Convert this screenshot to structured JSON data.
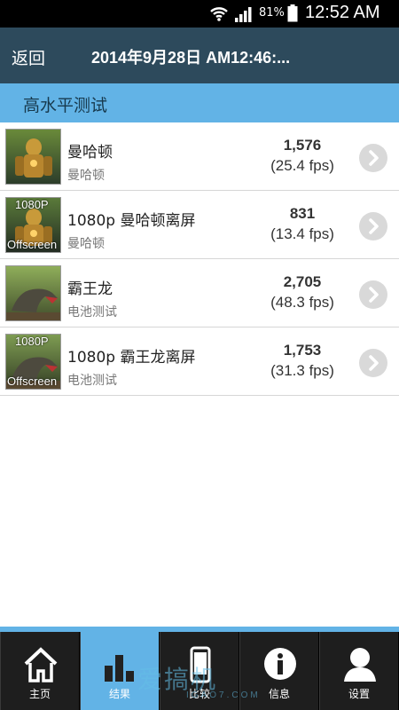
{
  "status_bar": {
    "battery_percent": "81%",
    "time": "12:52 AM",
    "icons": [
      "wifi-icon",
      "signal-icon",
      "battery-icon"
    ]
  },
  "header": {
    "back_label": "返回",
    "title": "2014年9月28日 AM12:46:..."
  },
  "section": {
    "title": "高水平测试"
  },
  "results": [
    {
      "thumb_top": "",
      "thumb_bottom": "",
      "name": "曼哈顿",
      "subtitle": "曼哈顿",
      "score": "1,576",
      "fps": "(25.4 fps)",
      "thumb_icon": "robot-thumbnail"
    },
    {
      "thumb_top": "1080P",
      "thumb_bottom": "Offscreen",
      "name": "1080p 曼哈顿离屏",
      "subtitle": "曼哈顿",
      "score": "831",
      "fps": "(13.4 fps)",
      "thumb_icon": "robot-thumbnail"
    },
    {
      "thumb_top": "",
      "thumb_bottom": "",
      "name": "霸王龙",
      "subtitle": "电池测试",
      "score": "2,705",
      "fps": "(48.3 fps)",
      "thumb_icon": "dinosaur-thumbnail"
    },
    {
      "thumb_top": "1080P",
      "thumb_bottom": "Offscreen",
      "name": "1080p 霸王龙离屏",
      "subtitle": "电池测试",
      "score": "1,753",
      "fps": "(31.3 fps)",
      "thumb_icon": "dinosaur-thumbnail"
    }
  ],
  "nav": {
    "active": "results",
    "items": [
      {
        "id": "home",
        "label": "主页",
        "icon": "home-icon"
      },
      {
        "id": "results",
        "label": "结果",
        "icon": "bar-chart-icon"
      },
      {
        "id": "compare",
        "label": "比较",
        "icon": "phone-icon"
      },
      {
        "id": "info",
        "label": "信息",
        "icon": "info-icon"
      },
      {
        "id": "settings",
        "label": "设置",
        "icon": "user-icon"
      }
    ]
  },
  "watermark": {
    "text": "爱搞机",
    "sub": "IGAO7.COM"
  },
  "colors": {
    "status_bar": "#000000",
    "title_bar": "#2d4a5c",
    "accent": "#62b3e6",
    "nav_bg": "#1e1e1e"
  }
}
